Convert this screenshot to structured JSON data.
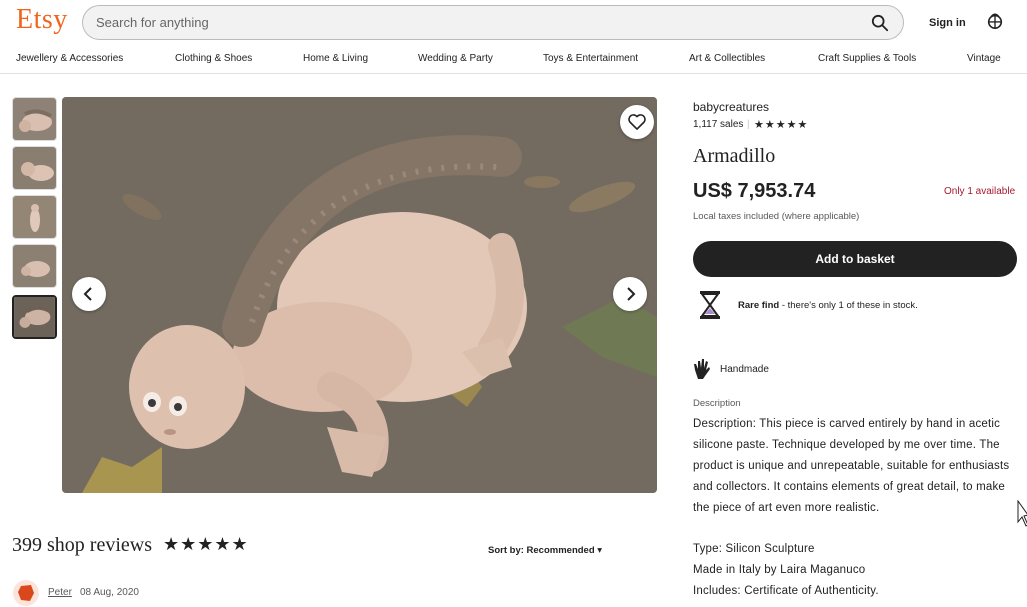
{
  "header": {
    "logo": "Etsy",
    "search_placeholder": "Search for anything",
    "sign_in": "Sign in"
  },
  "nav": {
    "items": [
      "Jewellery & Accessories",
      "Clothing & Shoes",
      "Home & Living",
      "Wedding & Party",
      "Toys & Entertainment",
      "Art & Collectibles",
      "Craft Supplies & Tools",
      "Vintage"
    ]
  },
  "listing": {
    "shop_name": "babycreatures",
    "sales": "1,117 sales",
    "shop_rating_stars": "★★★★★",
    "title": "Armadillo",
    "price": "US$ 7,953.74",
    "availability": "Only 1 available",
    "taxes": "Local taxes included (where applicable)",
    "add_to_basket": "Add to basket",
    "rare_find_bold": "Rare find",
    "rare_find_text": " - there's only 1 of these in stock.",
    "handmade": "Handmade",
    "description_label": "Description",
    "description": "Description: This piece is carved entirely by hand in acetic silicone paste. Technique developed by me over time. The product is unique and unrepeatable, suitable for enthusiasts and collectors. It contains elements of great detail, to make the piece of art even more realistic.",
    "details": [
      "Type: Silicon Sculpture",
      "Made in Italy by Laira Maganuco",
      "Includes: Certificate of Authenticity."
    ]
  },
  "reviews": {
    "title": "399 shop reviews",
    "stars": "★★★★★",
    "sort_label": "Sort by:",
    "sort_value": "Recommended",
    "first_reviewer": "Peter",
    "first_date": "08 Aug, 2020"
  },
  "colors": {
    "brand": "#f1641e",
    "availability": "#a61a2e",
    "button": "#222222"
  }
}
